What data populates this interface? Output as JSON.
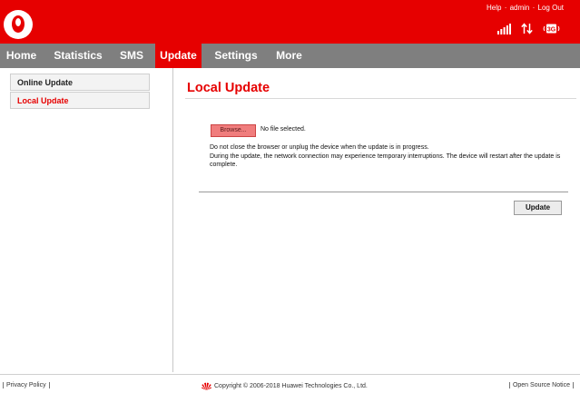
{
  "header": {
    "help_label": "Help",
    "user_label": "admin",
    "logout_label": "Log Out",
    "link_separator": "·",
    "network_type": "3G",
    "brand_color": "#e60000"
  },
  "nav": {
    "items": [
      {
        "label": "Home"
      },
      {
        "label": "Statistics"
      },
      {
        "label": "SMS"
      },
      {
        "label": "Update",
        "active": true
      },
      {
        "label": "Settings"
      },
      {
        "label": "More"
      }
    ]
  },
  "sidebar": {
    "items": [
      {
        "label": "Online Update"
      },
      {
        "label": "Local Update",
        "active": true
      }
    ]
  },
  "main": {
    "title": "Local Update",
    "browse_label": "Browse...",
    "file_status": "No file selected.",
    "note_line1": "Do not close the browser or unplug the device when the update is in progress.",
    "note_line2": "During the update, the network connection may experience temporary interruptions. The device will restart after the update is complete.",
    "update_label": "Update"
  },
  "footer": {
    "privacy_label": "Privacy Policy",
    "copyright": "Copyright © 2006-2018 Huawei Technologies Co., Ltd.",
    "open_source_label": "Open Source Notice"
  },
  "icons": {
    "logo": "vodafone-logo-icon",
    "signal": "signal-bars-icon",
    "data": "data-transfer-icon",
    "network": "network-3g-icon",
    "vendor": "huawei-logo-icon"
  }
}
